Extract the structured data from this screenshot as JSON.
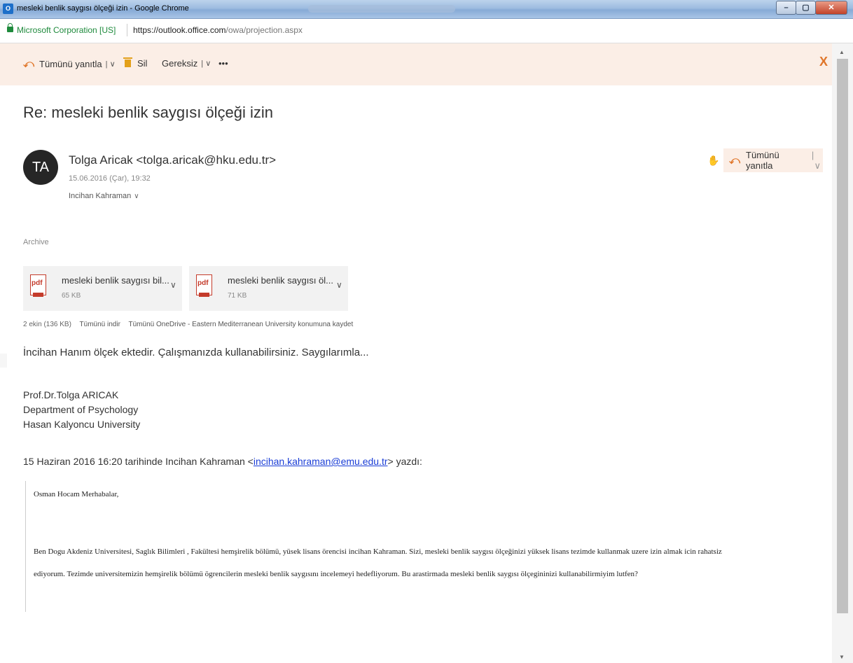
{
  "window": {
    "title": "mesleki benlik saygısı ölçeği izin - Google Chrome",
    "app_icon_label": "O",
    "buttons": {
      "minimize": "–",
      "maximize": "▢",
      "close": "✕"
    }
  },
  "address_bar": {
    "certificate": "Microsoft Corporation [US]",
    "url_domain": "https://outlook.office.com",
    "url_path": "/owa/projection.aspx"
  },
  "toolbar": {
    "reply_all": "Tümünü yanıtla",
    "delete": "Sil",
    "junk": "Gereksiz",
    "more": "•••",
    "close": "X",
    "accent_color": "#e0762a"
  },
  "message": {
    "subject": "Re: mesleki benlik saygısı ölçeği izin",
    "avatar_initials": "TA",
    "sender": "Tolga Aricak <tolga.aricak@hku.edu.tr>",
    "date": "15.06.2016 (Çar), 19:32",
    "recipient": "Incihan Kahraman",
    "reply_all": "Tümünü yanıtla",
    "folder": "Archive"
  },
  "attachments": {
    "items": [
      {
        "name": "mesleki benlik saygısı bil...",
        "size": "65 KB",
        "type": "pdf"
      },
      {
        "name": "mesleki benlik saygısı öl...",
        "size": "71 KB",
        "type": "pdf"
      }
    ],
    "summary": "2 ekin (136 KB)",
    "download_all": "Tümünü indir",
    "save_all": "Tümünü OneDrive - Eastern Mediterranean University konumuna kaydet"
  },
  "body": {
    "main": "İncihan Hanım ölçek ektedir. Çalışmanızda kullanabilirsiniz. Saygılarımla...",
    "signature": [
      "Prof.Dr.Tolga ARICAK",
      "Department of Psychology",
      "Hasan Kalyoncu University"
    ],
    "quote_intro_before": "15 Haziran 2016 16:20 tarihinde Incihan Kahraman <",
    "quote_email": "incihan.kahraman@emu.edu.tr",
    "quote_intro_after": "> yazdı:",
    "quoted_greeting": "Osman Hocam Merhabalar,",
    "quoted_line1": "Ben Dogu Akdeniz Universitesi, Saglık Bilimleri , Fakültesi hemşirelik bölümü, yüsek lisans örencisi incihan Kahraman. Sizi, mesleki benlik saygısı ölçeğinizi yüksek lisans tezimde kullanmak uzere izin almak icin rahatsiz",
    "quoted_line2": "ediyorum. Tezimde universitemizin hemşirelik bölümü ögrencilerin mesleki benlik saygısını incelemeyi hedefliyorum. Bu arastirmada mesleki benlik saygısı ölçegininizi kullanabilirmiyim lutfen?"
  }
}
